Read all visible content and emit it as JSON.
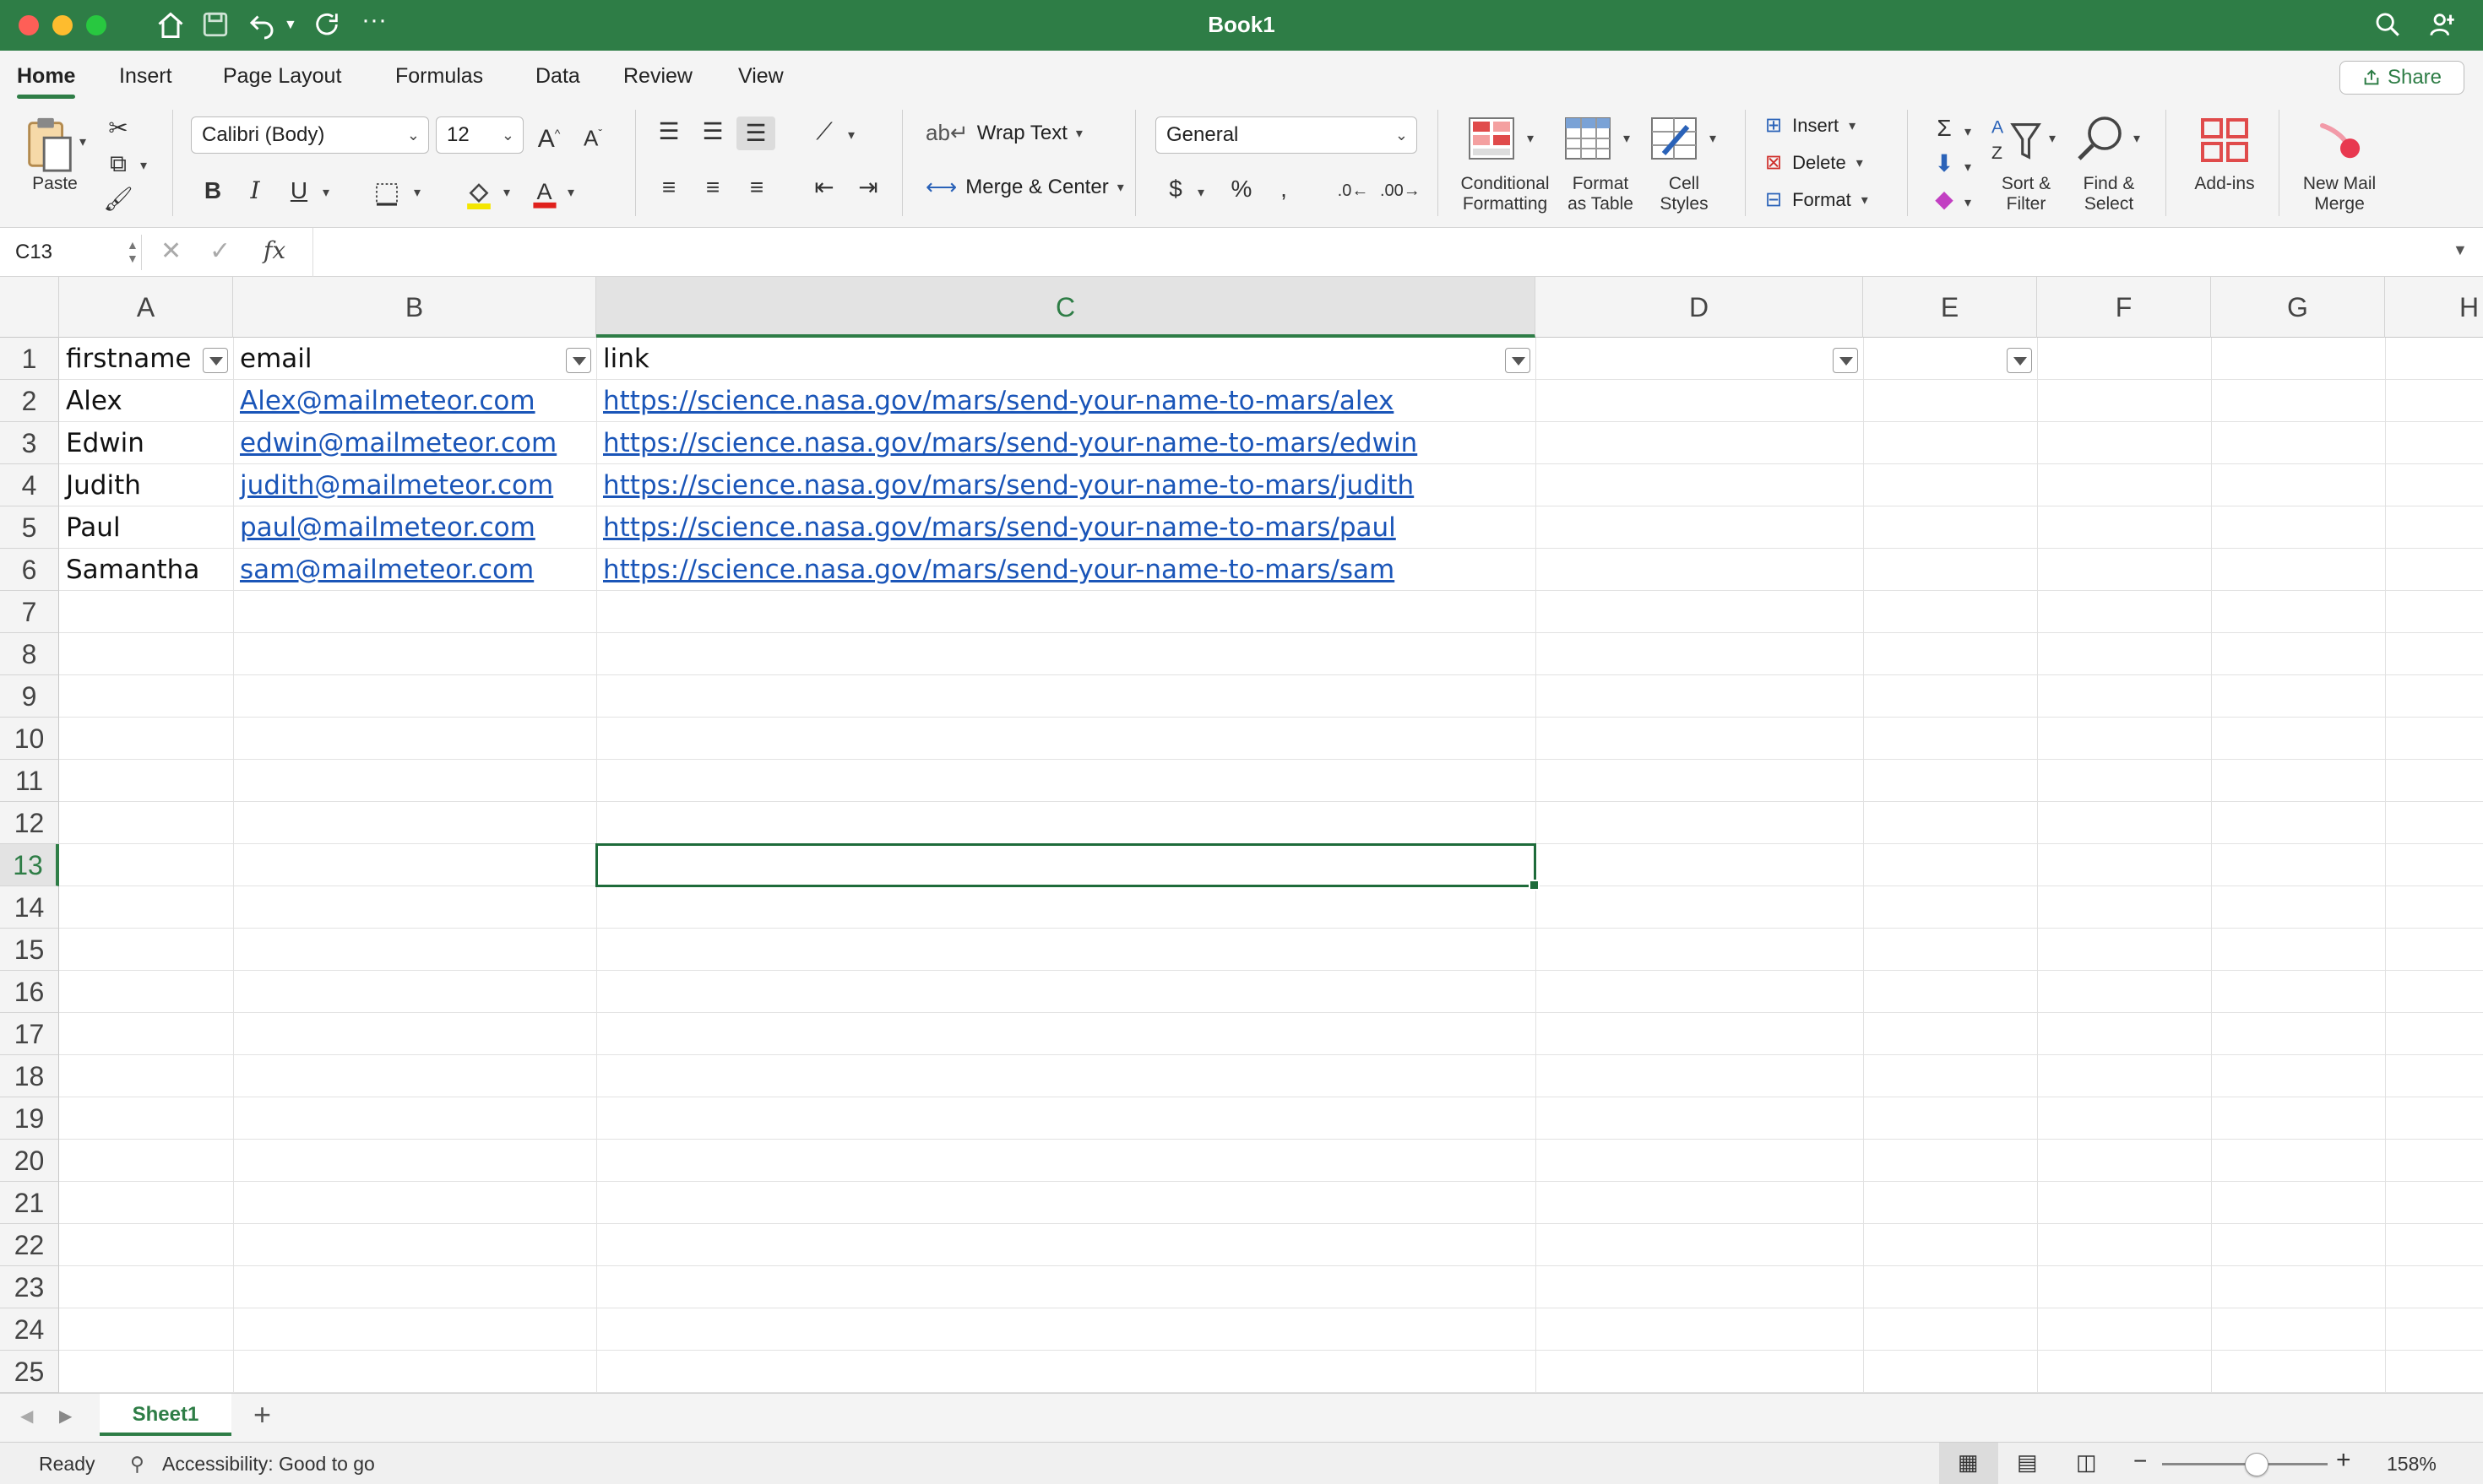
{
  "window": {
    "title": "Book1"
  },
  "tabs": [
    "Home",
    "Insert",
    "Page Layout",
    "Formulas",
    "Data",
    "Review",
    "View"
  ],
  "share_label": "Share",
  "ribbon": {
    "paste": "Paste",
    "font_name": "Calibri (Body)",
    "font_size": "12",
    "wrap_text": "Wrap Text",
    "merge_center": "Merge & Center",
    "number_format": "General",
    "conditional_formatting_l1": "Conditional",
    "conditional_formatting_l2": "Formatting",
    "format_table_l1": "Format",
    "format_table_l2": "as Table",
    "cell_styles_l1": "Cell",
    "cell_styles_l2": "Styles",
    "insert": "Insert",
    "delete": "Delete",
    "format": "Format",
    "sort_filter_l1": "Sort &",
    "sort_filter_l2": "Filter",
    "find_select_l1": "Find &",
    "find_select_l2": "Select",
    "addins": "Add-ins",
    "mail_merge_l1": "New Mail",
    "mail_merge_l2": "Merge"
  },
  "formula_bar": {
    "name_box": "C13",
    "fx": "fx",
    "value": ""
  },
  "columns": [
    "A",
    "B",
    "C",
    "D",
    "E",
    "F",
    "G",
    "H"
  ],
  "rows": [
    "1",
    "2",
    "3",
    "4",
    "5",
    "6",
    "7",
    "8",
    "9",
    "10",
    "11",
    "12",
    "13",
    "14",
    "15",
    "16",
    "17",
    "18",
    "19",
    "20",
    "21",
    "22",
    "23",
    "24",
    "25"
  ],
  "headers": {
    "a": "firstname",
    "b": "email",
    "c": "link"
  },
  "data_rows": [
    {
      "firstname": "Alex",
      "email": "Alex@mailmeteor.com",
      "link": "https://science.nasa.gov/mars/send-your-name-to-mars/alex"
    },
    {
      "firstname": "Edwin",
      "email": "edwin@mailmeteor.com",
      "link": "https://science.nasa.gov/mars/send-your-name-to-mars/edwin"
    },
    {
      "firstname": "Judith",
      "email": "judith@mailmeteor.com",
      "link": "https://science.nasa.gov/mars/send-your-name-to-mars/judith"
    },
    {
      "firstname": "Paul",
      "email": "paul@mailmeteor.com",
      "link": "https://science.nasa.gov/mars/send-your-name-to-mars/paul"
    },
    {
      "firstname": "Samantha",
      "email": "sam@mailmeteor.com",
      "link": "https://science.nasa.gov/mars/send-your-name-to-mars/sam"
    }
  ],
  "selected_cell": "C13",
  "sheet_tab": "Sheet1",
  "status": {
    "ready": "Ready",
    "accessibility": "Accessibility: Good to go",
    "zoom": "158%"
  },
  "colors": {
    "accent": "#2e7d46",
    "link": "#1a55b8"
  }
}
